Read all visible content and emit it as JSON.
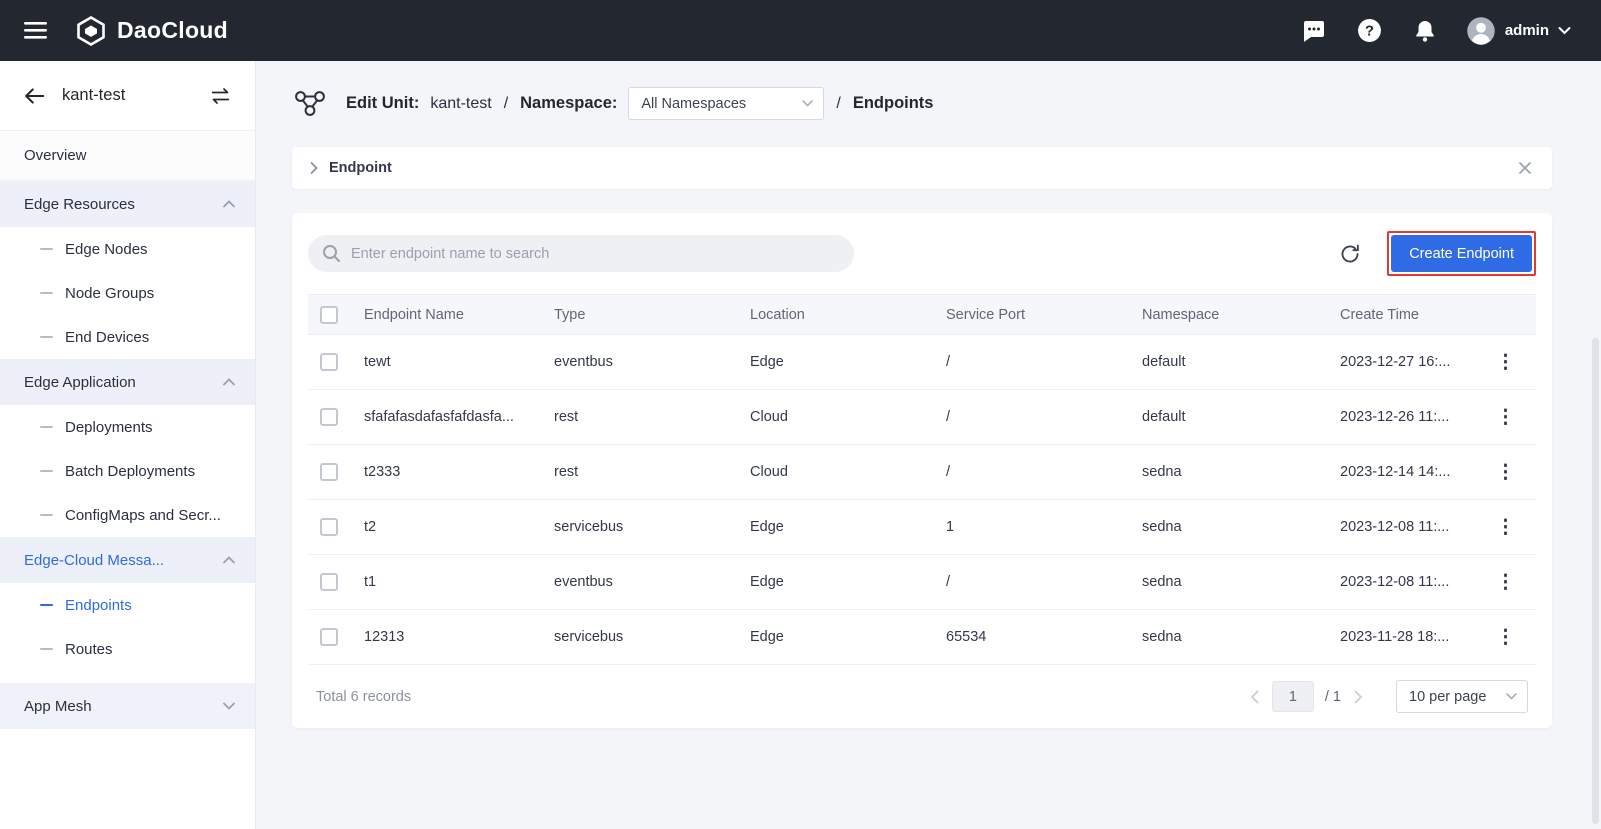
{
  "colors": {
    "accent": "#2f6be4",
    "highlight_red": "#e03a34",
    "topbar_bg": "#23272f"
  },
  "topbar": {
    "brand": "DaoCloud",
    "user": "admin"
  },
  "sidebar": {
    "back_title": "kant-test",
    "overview": "Overview",
    "sections": [
      {
        "label": "Edge Resources",
        "expanded": true,
        "children": [
          {
            "label": "Edge Nodes"
          },
          {
            "label": "Node Groups"
          },
          {
            "label": "End Devices"
          }
        ]
      },
      {
        "label": "Edge Application",
        "expanded": true,
        "children": [
          {
            "label": "Deployments"
          },
          {
            "label": "Batch Deployments"
          },
          {
            "label": "ConfigMaps and Secr..."
          }
        ]
      },
      {
        "label": "Edge-Cloud Messa...",
        "expanded": true,
        "active": true,
        "children": [
          {
            "label": "Endpoints",
            "active": true
          },
          {
            "label": "Routes"
          }
        ]
      },
      {
        "label": "App Mesh",
        "expanded": false,
        "children": []
      }
    ]
  },
  "breadcrumb": {
    "edit_unit_label": "Edit Unit:",
    "unit_name": "kant-test",
    "separator": "/",
    "namespace_label": "Namespace:",
    "namespace_value": "All Namespaces",
    "page": "Endpoints"
  },
  "panel": {
    "title": "Endpoint"
  },
  "toolbar": {
    "search_placeholder": "Enter endpoint name to search",
    "create_button": "Create Endpoint"
  },
  "table": {
    "headers": [
      "Endpoint Name",
      "Type",
      "Location",
      "Service Port",
      "Namespace",
      "Create Time"
    ],
    "rows": [
      {
        "name": "tewt",
        "type": "eventbus",
        "location": "Edge",
        "port": "/",
        "namespace": "default",
        "created": "2023-12-27 16:..."
      },
      {
        "name": "sfafafasdafasfafdasfa...",
        "type": "rest",
        "location": "Cloud",
        "port": "/",
        "namespace": "default",
        "created": "2023-12-26 11:..."
      },
      {
        "name": "t2333",
        "type": "rest",
        "location": "Cloud",
        "port": "/",
        "namespace": "sedna",
        "created": "2023-12-14 14:..."
      },
      {
        "name": "t2",
        "type": "servicebus",
        "location": "Edge",
        "port": "1",
        "namespace": "sedna",
        "created": "2023-12-08 11:..."
      },
      {
        "name": "t1",
        "type": "eventbus",
        "location": "Edge",
        "port": "/",
        "namespace": "sedna",
        "created": "2023-12-08 11:..."
      },
      {
        "name": "12313",
        "type": "servicebus",
        "location": "Edge",
        "port": "65534",
        "namespace": "sedna",
        "created": "2023-11-28 18:..."
      }
    ]
  },
  "footer": {
    "total": "Total 6 records",
    "page": "1",
    "page_total": "/ 1",
    "per_page": "10 per page"
  }
}
